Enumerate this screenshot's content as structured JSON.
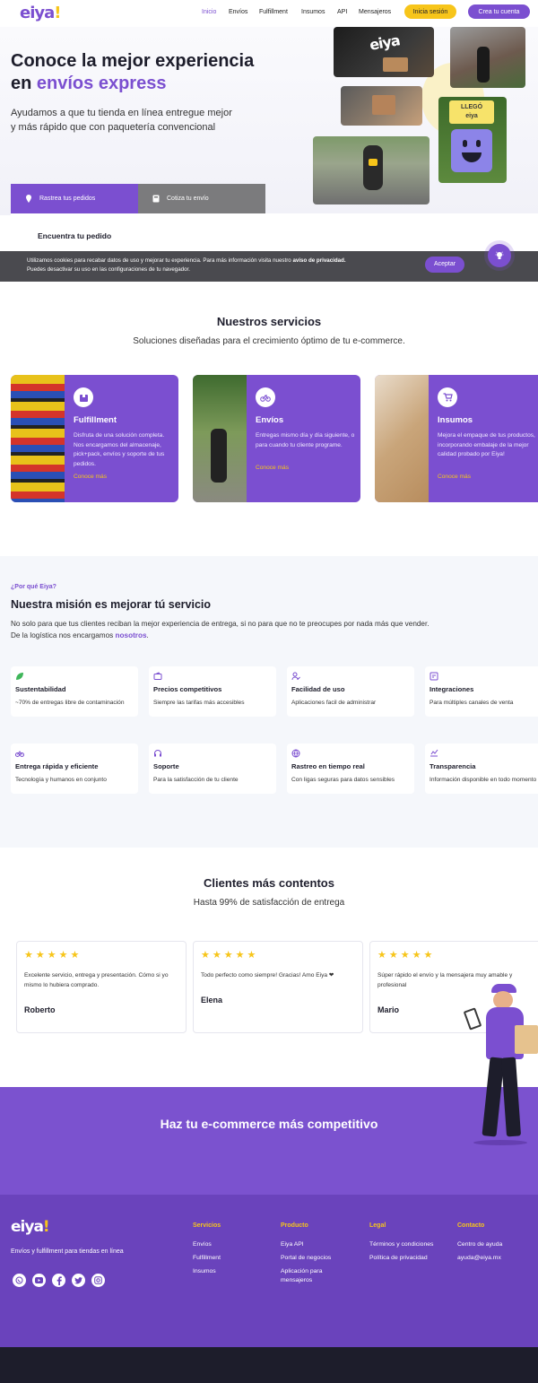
{
  "nav": {
    "logo": {
      "text": "eiya",
      "accent": "!"
    },
    "links": [
      "Inicio",
      "Envíos",
      "Fulfillment",
      "Insumos",
      "API",
      "Mensajeros"
    ],
    "login": "Inicia sesión",
    "signup": "Crea tu cuenta"
  },
  "hero": {
    "title_line1": "Conoce la mejor experiencia",
    "title_prefix": "en ",
    "title_highlight": "envíos express",
    "subtitle_line1": "Ayudamos a que tu tienda en línea entregue mejor",
    "subtitle_line2": "y más rápido que con paquetería convencional",
    "photo_labels": {
      "brand": "eiya",
      "sign_top": "LLEGÓ",
      "sign_bottom": "eiya"
    }
  },
  "tabs": {
    "track": "Rastrea tus pedidos",
    "quote": "Cotiza tu envío",
    "find_label": "Encuentra tu pedido"
  },
  "cookie": {
    "line1_prefix": "Utilizamos cookies para recabar datos de uso y mejorar tu experiencia. Para más información visita nuestro ",
    "line1_link": "aviso de privacidad.",
    "line2": "Puedes desactivar su uso en las configuraciones de tu navegador.",
    "accept": "Aceptar"
  },
  "services": {
    "title": "Nuestros servicios",
    "subtitle": "Soluciones diseñadas para el crecimiento óptimo de tu e-commerce.",
    "items": [
      {
        "title": "Fulfillment",
        "desc": "Disfruta de una solución completa. Nos encargamos del almacenaje, pick+pack, envíos y soporte de tus pedidos.",
        "link": "Conoce más"
      },
      {
        "title": "Envíos",
        "desc": "Entregas mismo día y día siguiente, o para cuando tu cliente programe.",
        "link": "Conoce más"
      },
      {
        "title": "Insumos",
        "desc": "Mejora el empaque de tus productos, incorporando embalaje de la mejor calidad probado por Eiya!",
        "link": "Conoce más"
      }
    ]
  },
  "why": {
    "eyebrow": "¿Por qué Eiya?",
    "title": "Nuestra misión es mejorar tú servicio",
    "line1": "No solo para que tus clientes reciban la mejor experiencia de entrega, si no para que no te preocupes por nada más que vender.",
    "line2_prefix": "De la logística nos encargamos ",
    "line2_highlight": "nosotros",
    "line2_suffix": ".",
    "features": [
      {
        "title": "Sustentabilidad",
        "desc": "~70% de entregas libre de contaminación",
        "icon": "leaf-icon"
      },
      {
        "title": "Precios competitivos",
        "desc": "Siempre las tarifas más accesibles",
        "icon": "wallet-icon"
      },
      {
        "title": "Facilidad de uso",
        "desc": "Aplicaciones facil de administrar",
        "icon": "user-check-icon"
      },
      {
        "title": "Integraciones",
        "desc": "Para múltiples canales de venta",
        "icon": "integration-icon"
      },
      {
        "title": "Entrega rápida y eficiente",
        "desc": "Tecnología y humanos en conjunto",
        "icon": "bicycle-icon"
      },
      {
        "title": "Soporte",
        "desc": "Para la satisfacción de tu cliente",
        "icon": "headset-icon"
      },
      {
        "title": "Rastreo en tiempo real",
        "desc": "Con ligas seguras para datos sensibles",
        "icon": "globe-icon"
      },
      {
        "title": "Transparencia",
        "desc": "Información disponible en todo momento",
        "icon": "transparency-icon"
      }
    ]
  },
  "reviews": {
    "title": "Clientes más contentos",
    "subtitle": "Hasta 99% de satisfacción de entrega",
    "stars": "★★★★★",
    "items": [
      {
        "text": "Excelente servicio, entrega y presentación. Cómo si yo mismo lo hubiera comprado.",
        "name": "Roberto"
      },
      {
        "text": "Todo perfecto como siempre! Gracias! Amo Eiya ❤",
        "name": "Elena"
      },
      {
        "text": "Súper rápido el envío y la mensajera muy amable y profesional",
        "name": "Mario"
      }
    ]
  },
  "cta": {
    "title": "Haz tu e-commerce más competitivo"
  },
  "footer": {
    "tagline": "Envíos y fulfillment para tiendas en línea",
    "columns": [
      {
        "heading": "Servicios",
        "items": [
          "Envíos",
          "Fulfillment",
          "Insumos"
        ]
      },
      {
        "heading": "Producto",
        "items": [
          "Eiya API",
          "Portal de negocios",
          "Aplicación para mensajeros"
        ]
      },
      {
        "heading": "Legal",
        "items": [
          "Términos y condiciones",
          "Política de privacidad"
        ]
      },
      {
        "heading": "Contacto",
        "items": [
          "Centro de ayuda",
          "ayuda@eiya.mx"
        ]
      }
    ],
    "social": [
      "whatsapp-icon",
      "youtube-icon",
      "facebook-icon",
      "twitter-icon",
      "instagram-icon"
    ]
  },
  "colors": {
    "brand": "#7b4fd0",
    "accent": "#f7c51a",
    "dark": "#1d1d2b",
    "footer": "#6a43bc"
  }
}
